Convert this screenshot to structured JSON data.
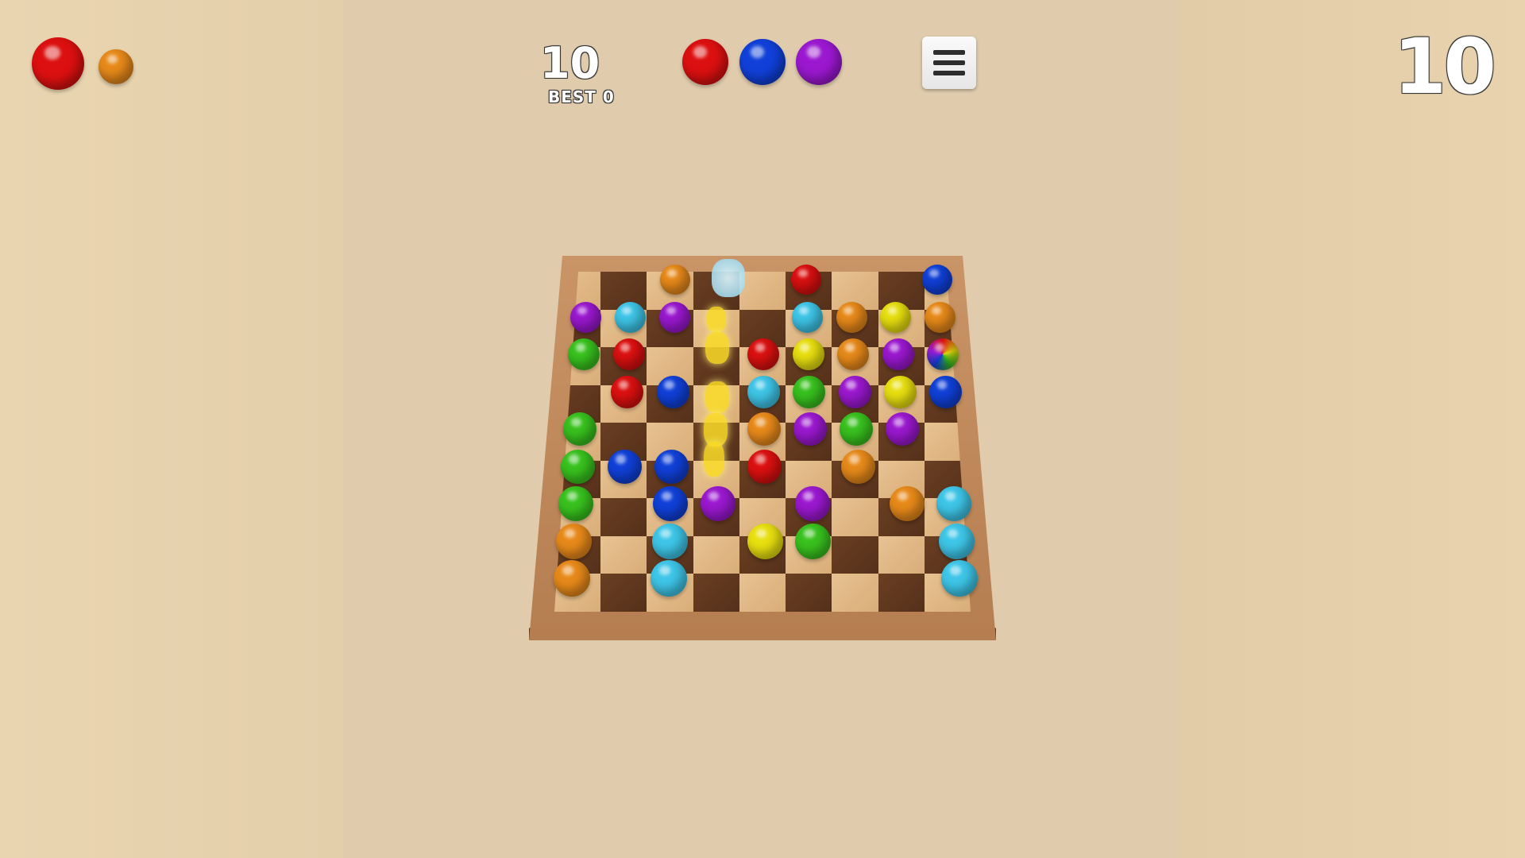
{
  "hud": {
    "score": "10",
    "best_label": "BEST",
    "best_value": "0",
    "big_score": "10"
  },
  "colors": {
    "red": "#dc1010",
    "orange": "#e88a1a",
    "yellow": "#e8e010",
    "green": "#38c21e",
    "cyan": "#3ec6e8",
    "blue": "#1040d8",
    "purple": "#9b18d0"
  },
  "current_balls": [
    "red",
    "orange"
  ],
  "next_balls": [
    "red",
    "blue",
    "purple"
  ],
  "board": {
    "rows": 9,
    "cols": 9,
    "grid": [
      [
        "",
        "",
        "orange",
        "",
        "",
        "red",
        "",
        "",
        "blue"
      ],
      [
        "purple",
        "cyan",
        "purple",
        "",
        "",
        "cyan",
        "orange",
        "yellow",
        "orange"
      ],
      [
        "green",
        "red",
        "",
        "",
        "red",
        "yellow",
        "orange",
        "purple",
        "multicolor"
      ],
      [
        "",
        "red",
        "blue",
        "",
        "cyan",
        "green",
        "purple",
        "yellow",
        "blue"
      ],
      [
        "green",
        "",
        "",
        "",
        "orange",
        "purple",
        "green",
        "purple",
        ""
      ],
      [
        "green",
        "blue",
        "blue",
        "",
        "red",
        "",
        "orange",
        "",
        ""
      ],
      [
        "green",
        "",
        "blue",
        "purple",
        "",
        "purple",
        "",
        "orange",
        "cyan"
      ],
      [
        "orange",
        "",
        "cyan",
        "",
        "yellow",
        "green",
        "",
        "",
        "cyan"
      ],
      [
        "orange",
        "",
        "cyan",
        "",
        "",
        "",
        "",
        "",
        "cyan"
      ]
    ]
  }
}
